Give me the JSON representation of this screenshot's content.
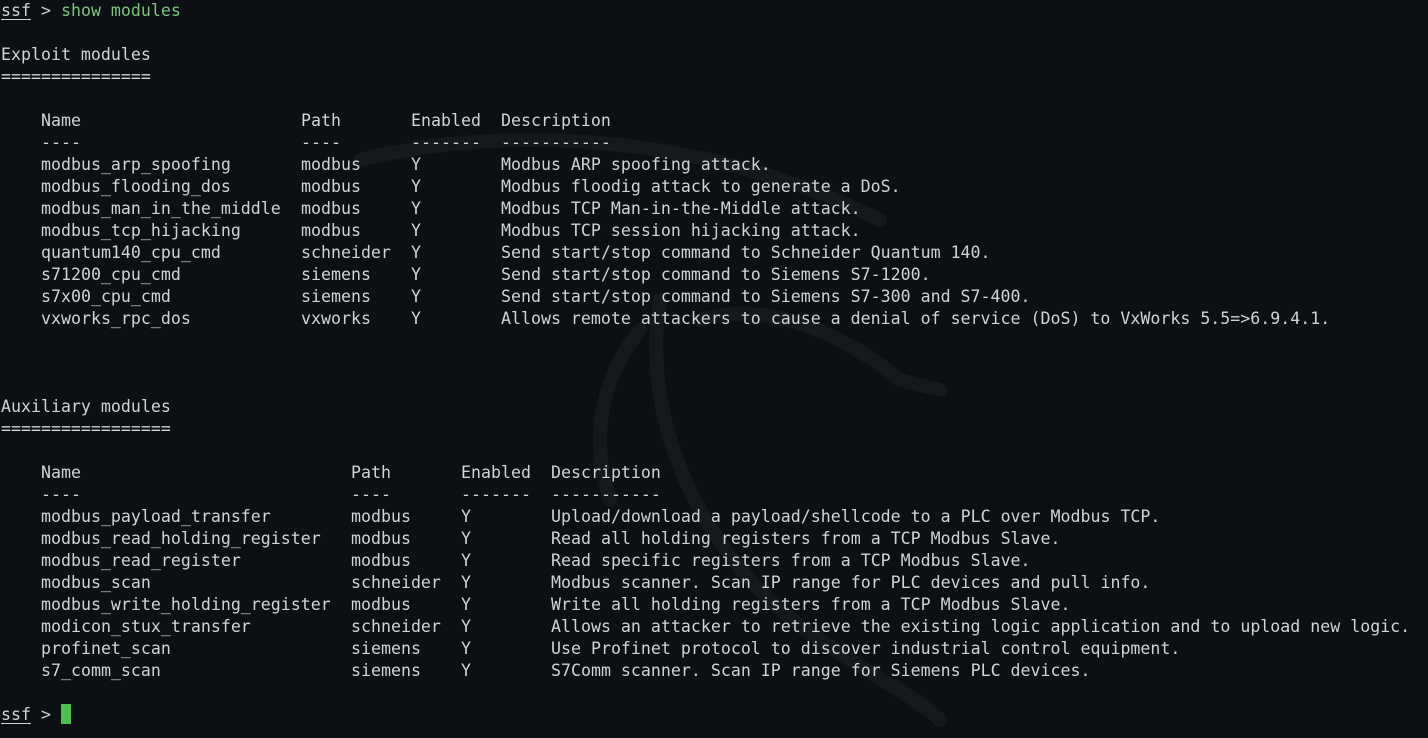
{
  "prompt": {
    "host": "ssf",
    "symbol": ">",
    "command": "show modules"
  },
  "colors": {
    "background": "#0c0f13",
    "text": "#d0d4d8",
    "command": "#7ec27e",
    "cursor": "#4fbf52"
  },
  "exploit": {
    "title": "Exploit modules",
    "underline": "===============",
    "headers": {
      "name": "Name",
      "path": "Path",
      "enabled": "Enabled",
      "description": "Description"
    },
    "separators": {
      "name": "----",
      "path": "----",
      "enabled": "-------",
      "description": "-----------"
    },
    "rows": [
      {
        "name": "modbus_arp_spoofing",
        "path": "modbus",
        "enabled": "Y",
        "description": "Modbus ARP spoofing attack."
      },
      {
        "name": "modbus_flooding_dos",
        "path": "modbus",
        "enabled": "Y",
        "description": "Modbus floodig attack to generate a DoS."
      },
      {
        "name": "modbus_man_in_the_middle",
        "path": "modbus",
        "enabled": "Y",
        "description": "Modbus TCP Man-in-the-Middle attack."
      },
      {
        "name": "modbus_tcp_hijacking",
        "path": "modbus",
        "enabled": "Y",
        "description": "Modbus TCP session hijacking attack."
      },
      {
        "name": "quantum140_cpu_cmd",
        "path": "schneider",
        "enabled": "Y",
        "description": "Send start/stop command to Schneider Quantum 140."
      },
      {
        "name": "s71200_cpu_cmd",
        "path": "siemens",
        "enabled": "Y",
        "description": "Send start/stop command to Siemens S7-1200."
      },
      {
        "name": "s7x00_cpu_cmd",
        "path": "siemens",
        "enabled": "Y",
        "description": "Send start/stop command to Siemens S7-300 and S7-400."
      },
      {
        "name": "vxworks_rpc_dos",
        "path": "vxworks",
        "enabled": "Y",
        "description": "Allows remote attackers to cause a denial of service (DoS) to VxWorks 5.5=>6.9.4.1."
      }
    ]
  },
  "auxiliary": {
    "title": "Auxiliary modules",
    "underline": "=================",
    "headers": {
      "name": "Name",
      "path": "Path",
      "enabled": "Enabled",
      "description": "Description"
    },
    "separators": {
      "name": "----",
      "path": "----",
      "enabled": "-------",
      "description": "-----------"
    },
    "rows": [
      {
        "name": "modbus_payload_transfer",
        "path": "modbus",
        "enabled": "Y",
        "description": "Upload/download a payload/shellcode to a PLC over Modbus TCP."
      },
      {
        "name": "modbus_read_holding_register",
        "path": "modbus",
        "enabled": "Y",
        "description": "Read all holding registers from a TCP Modbus Slave."
      },
      {
        "name": "modbus_read_register",
        "path": "modbus",
        "enabled": "Y",
        "description": "Read specific registers from a TCP Modbus Slave."
      },
      {
        "name": "modbus_scan",
        "path": "schneider",
        "enabled": "Y",
        "description": "Modbus scanner. Scan IP range for PLC devices and pull info."
      },
      {
        "name": "modbus_write_holding_register",
        "path": "modbus",
        "enabled": "Y",
        "description": "Write all holding registers from a TCP Modbus Slave."
      },
      {
        "name": "modicon_stux_transfer",
        "path": "schneider",
        "enabled": "Y",
        "description": "Allows an attacker to retrieve the existing logic application and to upload new logic."
      },
      {
        "name": "profinet_scan",
        "path": "siemens",
        "enabled": "Y",
        "description": "Use Profinet protocol to discover industrial control equipment."
      },
      {
        "name": "s7_comm_scan",
        "path": "siemens",
        "enabled": "Y",
        "description": "S7Comm scanner. Scan IP range for Siemens PLC devices."
      }
    ]
  }
}
